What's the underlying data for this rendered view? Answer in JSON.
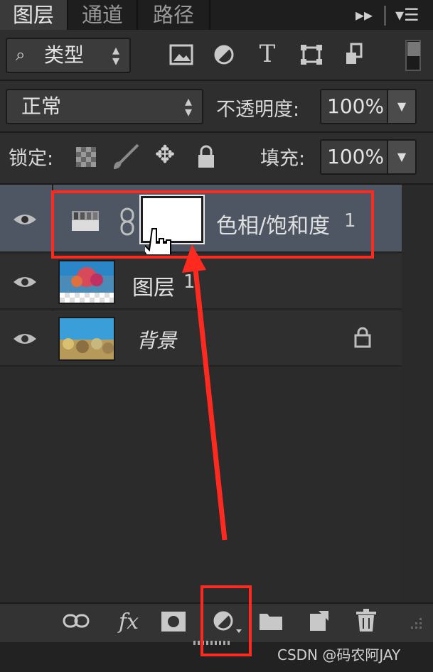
{
  "tabs": [
    {
      "label": "图层"
    },
    {
      "label": "通道"
    },
    {
      "label": "路径"
    }
  ],
  "filter": {
    "label": "类型"
  },
  "blend": {
    "mode": "正常",
    "opacity_label": "不透明度:",
    "opacity_value": "100%"
  },
  "lock": {
    "label": "锁定:",
    "fill_label": "填充:",
    "fill_value": "100%"
  },
  "layers": [
    {
      "name": "色相/饱和度",
      "index": "1",
      "selected": true,
      "type": "adjustment"
    },
    {
      "name": "图层",
      "index": "1",
      "selected": false,
      "type": "pixel"
    },
    {
      "name": "背景",
      "index": "",
      "selected": false,
      "type": "background",
      "locked": true
    }
  ],
  "bottom_icons": [
    "link-icon",
    "fx-icon",
    "mask-icon",
    "adjustment-icon",
    "folder-icon",
    "new-layer-icon",
    "trash-icon"
  ],
  "fx_label": "fx",
  "watermark": "CSDN @码农阿JAY",
  "colors": {
    "annotation": "#ff2a1f",
    "selected_row": "#4d5662",
    "panel": "#2e2e2e"
  }
}
